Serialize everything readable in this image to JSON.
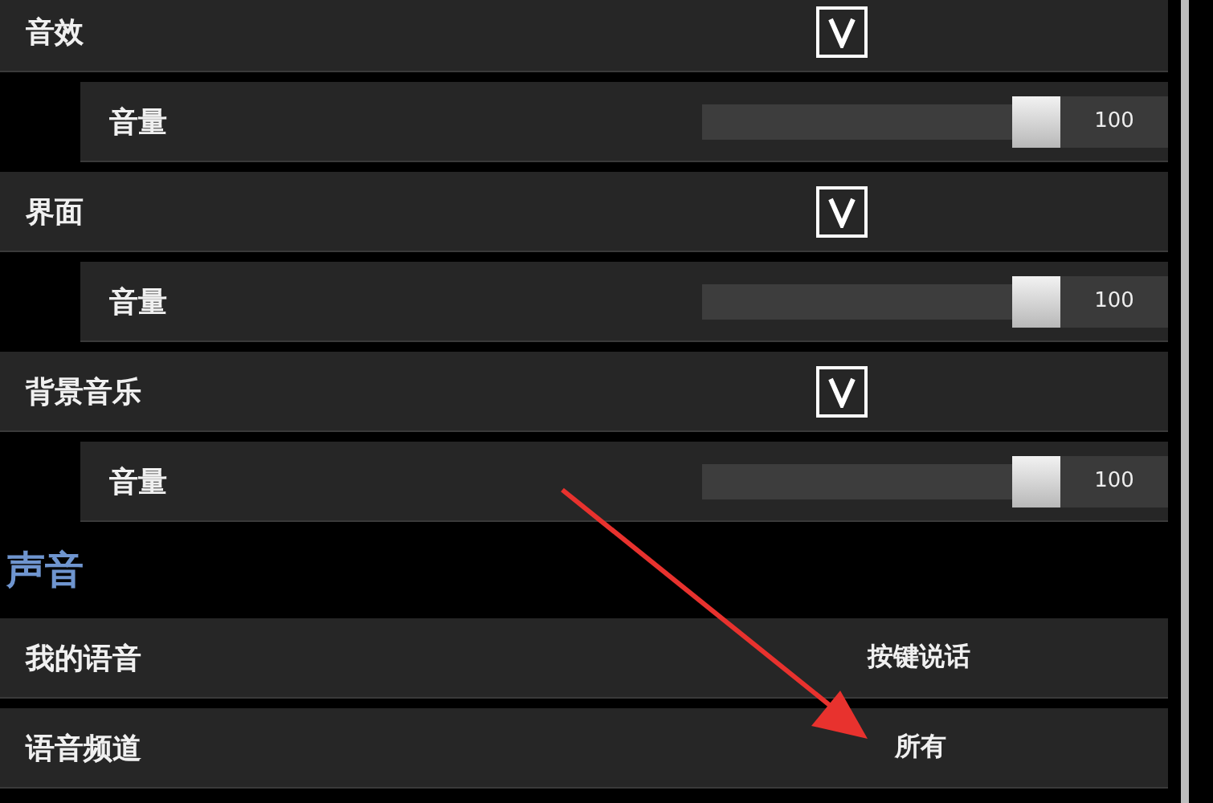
{
  "audio_rows": [
    {
      "kind": "toggle",
      "label": "音效",
      "checked": true
    },
    {
      "kind": "slider",
      "label": "音量",
      "level": 1,
      "reading": "100"
    },
    {
      "kind": "toggle",
      "label": "界面",
      "checked": true
    },
    {
      "kind": "slider",
      "label": "音量",
      "level": 1,
      "reading": "100"
    },
    {
      "kind": "toggle",
      "label": "背景音乐",
      "checked": true
    },
    {
      "kind": "slider",
      "label": "音量",
      "level": 1,
      "reading": "100"
    }
  ],
  "section_title": "声音",
  "voice_rows": [
    {
      "label": "我的语音",
      "value": "按键说话"
    },
    {
      "label": "语音频道",
      "value": "所有"
    }
  ]
}
